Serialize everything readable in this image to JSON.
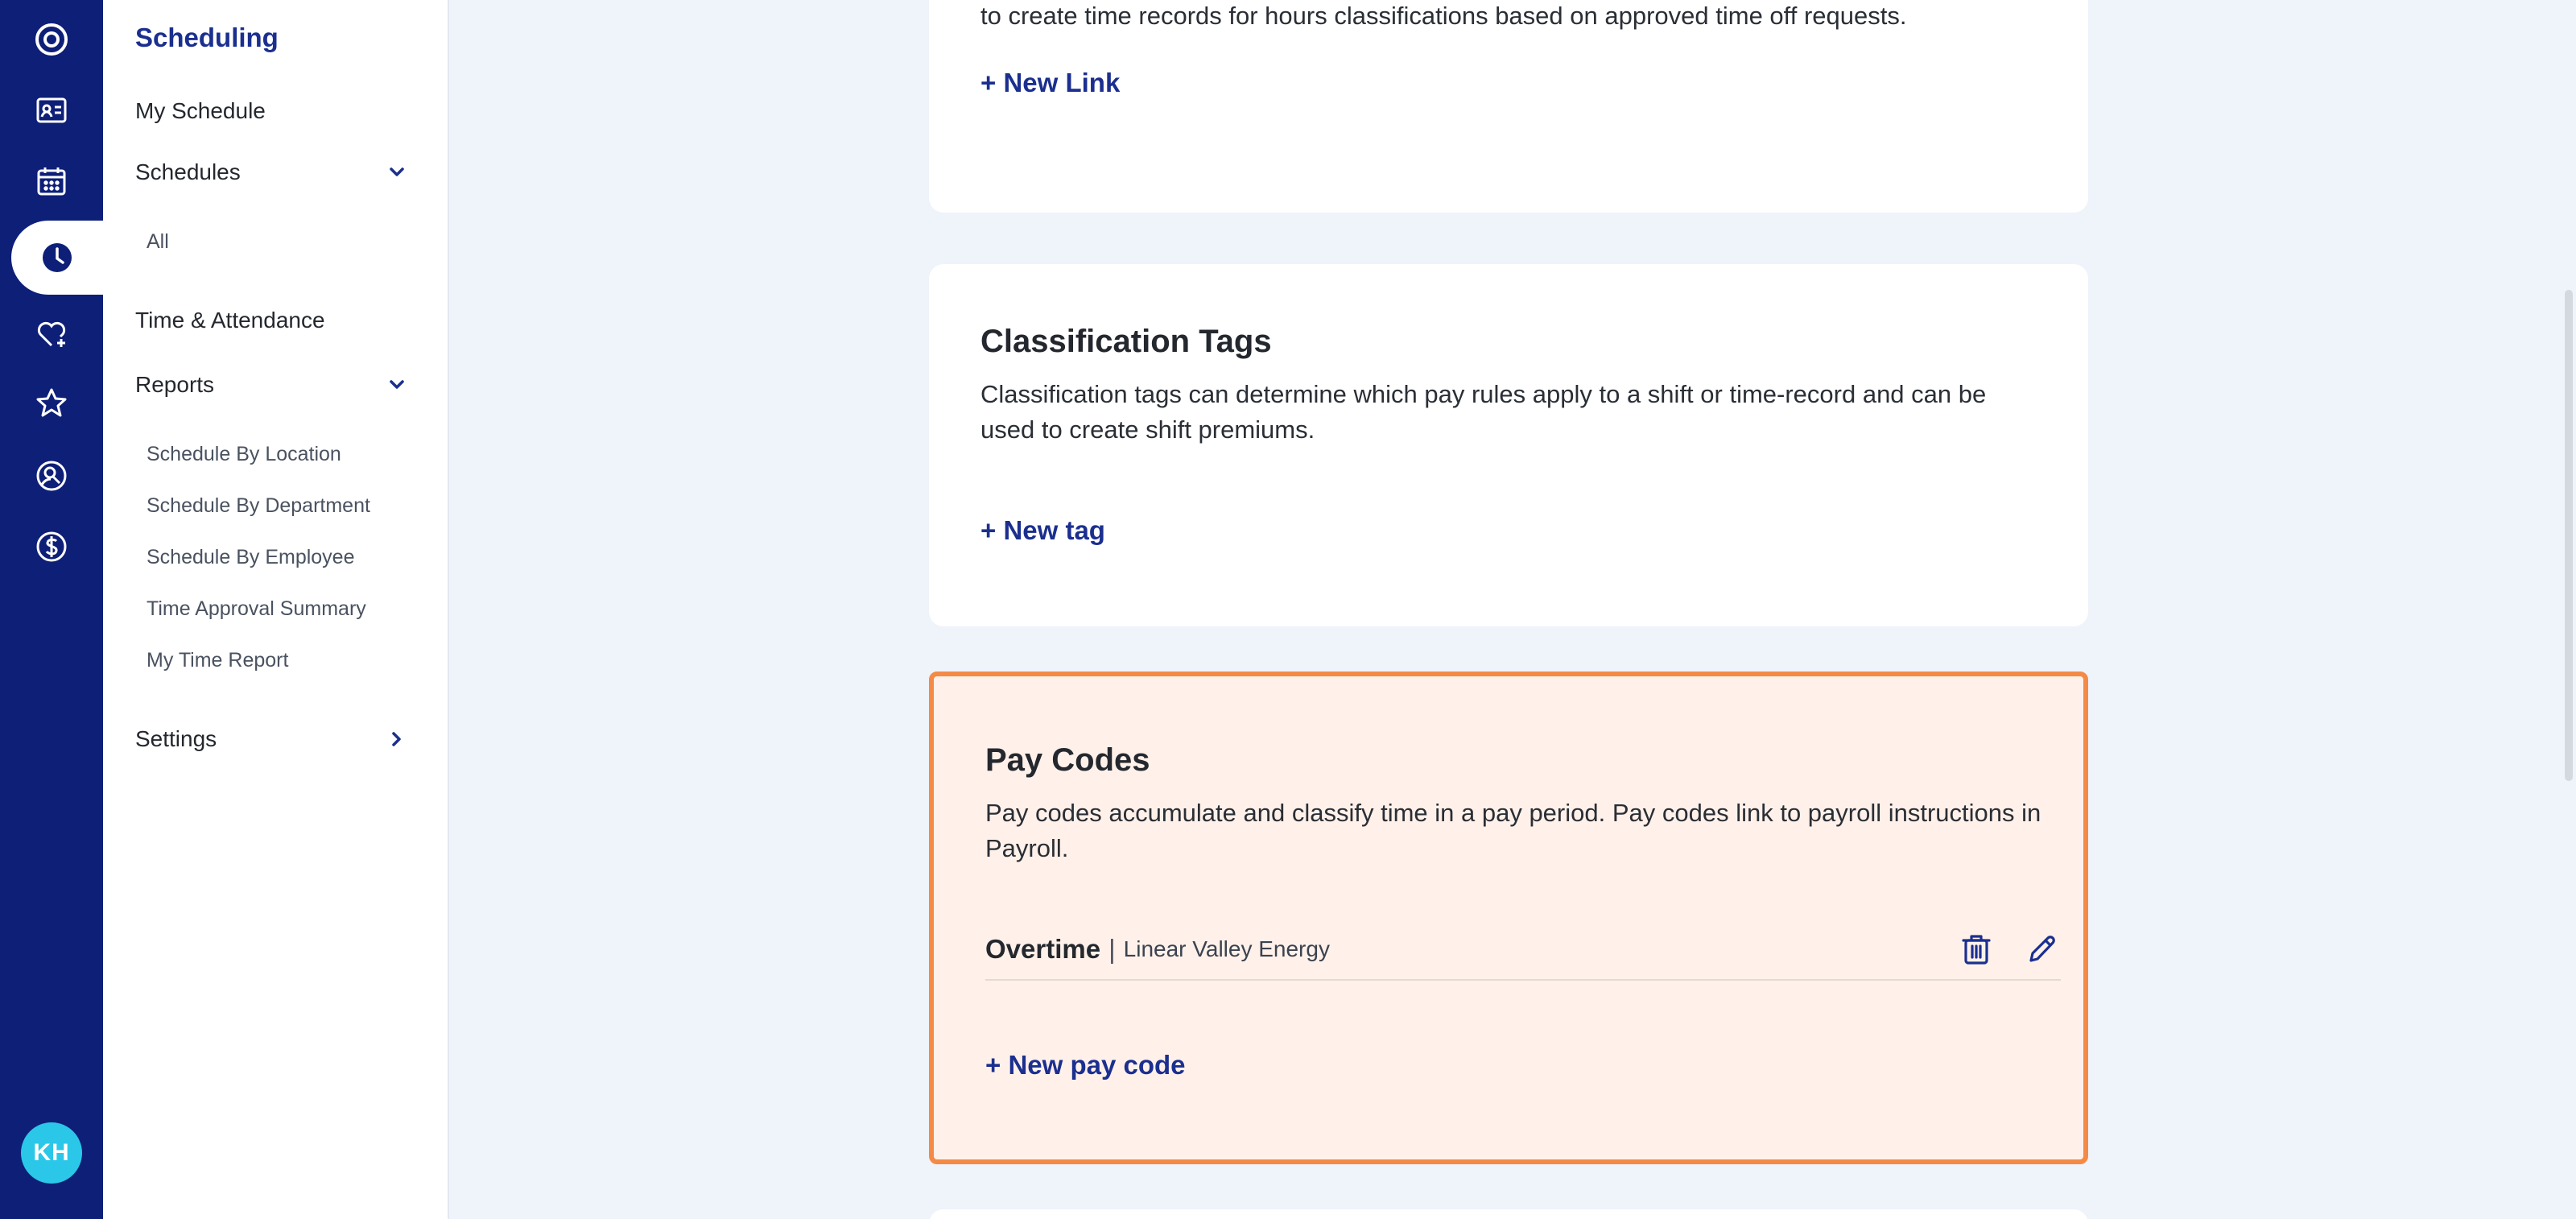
{
  "rail": {
    "icons": [
      "logo-icon",
      "id-card-icon",
      "calendar-icon",
      "clock-icon",
      "heart-icon",
      "star-icon",
      "user-search-icon",
      "dollar-icon"
    ],
    "avatar_initials": "KH",
    "colors": {
      "background": "#0e1f78",
      "active": "#ffffff",
      "avatar": "#2bc7e8"
    }
  },
  "subnav": {
    "title": "Scheduling",
    "my_schedule": "My Schedule",
    "schedules": "Schedules",
    "schedules_all": "All",
    "time_attendance": "Time & Attendance",
    "reports": "Reports",
    "report_items": [
      "Schedule By Location",
      "Schedule By Department",
      "Schedule By Employee",
      "Time Approval Summary",
      "My Time Report"
    ],
    "settings": "Settings"
  },
  "cards": {
    "top": {
      "desc_tail": "to create time records for hours classifications based on approved time off requests.",
      "action": "+ New Link"
    },
    "classification_tags": {
      "title": "Classification Tags",
      "desc": "Classification tags can determine which pay rules apply to a shift or time-record and can be used to create shift premiums.",
      "action": "+ New tag"
    },
    "pay_codes": {
      "title": "Pay Codes",
      "desc": "Pay codes accumulate and classify time in a pay period. Pay codes link to payroll instructions in Payroll.",
      "items": [
        {
          "name": "Overtime",
          "separator": "|",
          "org": "Linear Valley Energy"
        }
      ],
      "action": "+ New pay code"
    }
  },
  "colors": {
    "accent": "#1b2f8f",
    "highlight_border": "#f48a45",
    "highlight_bg": "#fff1ea",
    "page_bg": "#eff3fa"
  }
}
